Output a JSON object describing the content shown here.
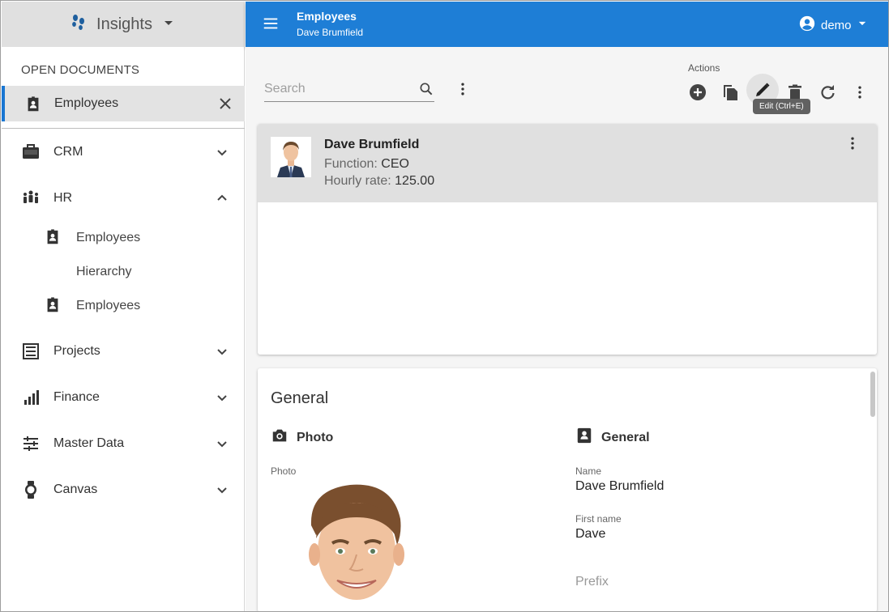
{
  "app": {
    "title": "Insights"
  },
  "sidebar": {
    "section_label": "OPEN DOCUMENTS",
    "open_document": {
      "label": "Employees"
    },
    "nav": [
      {
        "label": "CRM"
      },
      {
        "label": "HR"
      },
      {
        "label": "Employees"
      },
      {
        "label": "Hierarchy"
      },
      {
        "label": "Employees"
      },
      {
        "label": "Projects"
      },
      {
        "label": "Finance"
      },
      {
        "label": "Master Data"
      },
      {
        "label": "Canvas"
      }
    ]
  },
  "header": {
    "title": "Employees",
    "subtitle": "Dave Brumfield",
    "user": "demo"
  },
  "toolbar": {
    "search_placeholder": "Search",
    "actions_label": "Actions",
    "tooltip": "Edit (Ctrl+E)"
  },
  "record": {
    "name": "Dave Brumfield",
    "function_label": "Function:",
    "function_value": "CEO",
    "rate_label": "Hourly rate:",
    "rate_value": "125.00"
  },
  "detail": {
    "title": "General",
    "photo_section": "Photo",
    "general_section": "General",
    "photo_label": "Photo",
    "name_label": "Name",
    "name_value": "Dave Brumfield",
    "first_name_label": "First name",
    "first_name_value": "Dave",
    "prefix_label": "Prefix"
  },
  "colors": {
    "header": "#1e7ed6",
    "accent": "#1976d2",
    "selected": "#e3e3e3"
  },
  "icons": [
    "footsteps-icon",
    "badge-icon",
    "briefcase-icon",
    "people-icon",
    "list-icon",
    "chart-icon",
    "sliders-icon",
    "watch-icon",
    "plus-icon",
    "copy-icon",
    "pencil-icon",
    "trash-icon",
    "refresh-icon",
    "camera-icon",
    "account-icon"
  ]
}
